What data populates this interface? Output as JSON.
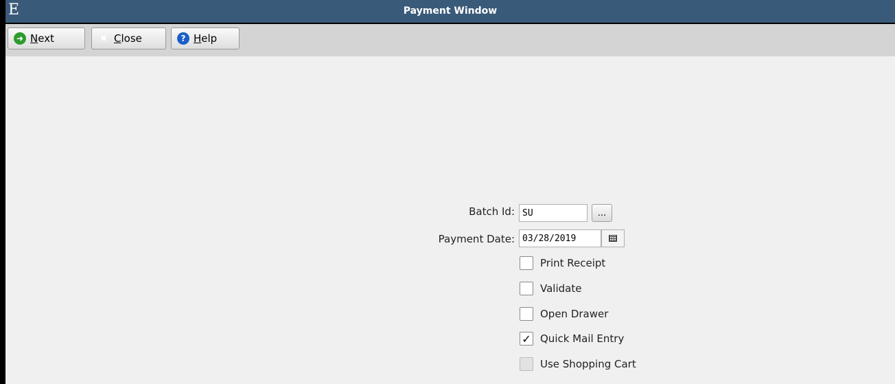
{
  "window": {
    "logo": "E",
    "title": "Payment Window"
  },
  "toolbar": {
    "next": {
      "mnemonic": "N",
      "rest": "ext",
      "icon": "arrow-right-icon"
    },
    "close": {
      "mnemonic": "C",
      "rest": "lose",
      "icon": "close-x-icon"
    },
    "help": {
      "mnemonic": "H",
      "rest": "elp",
      "icon": "question-icon"
    }
  },
  "form": {
    "batch_id": {
      "label": "Batch Id:",
      "value": "SU",
      "lookup_label": "..."
    },
    "payment_date": {
      "label": "Payment Date:",
      "value": "03/28/2019",
      "icon": "calendar-icon"
    },
    "checkboxes": [
      {
        "label": "Print Receipt",
        "checked": false,
        "enabled": true
      },
      {
        "label": "Validate",
        "checked": false,
        "enabled": true
      },
      {
        "label": "Open Drawer",
        "checked": false,
        "enabled": true
      },
      {
        "label": "Quick Mail Entry",
        "checked": true,
        "enabled": true
      },
      {
        "label": "Use Shopping Cart",
        "checked": false,
        "enabled": false
      }
    ]
  },
  "colors": {
    "titlebar": "#3a5a7a",
    "toolbar": "#d4d4d4",
    "background": "#f0f0f0"
  }
}
